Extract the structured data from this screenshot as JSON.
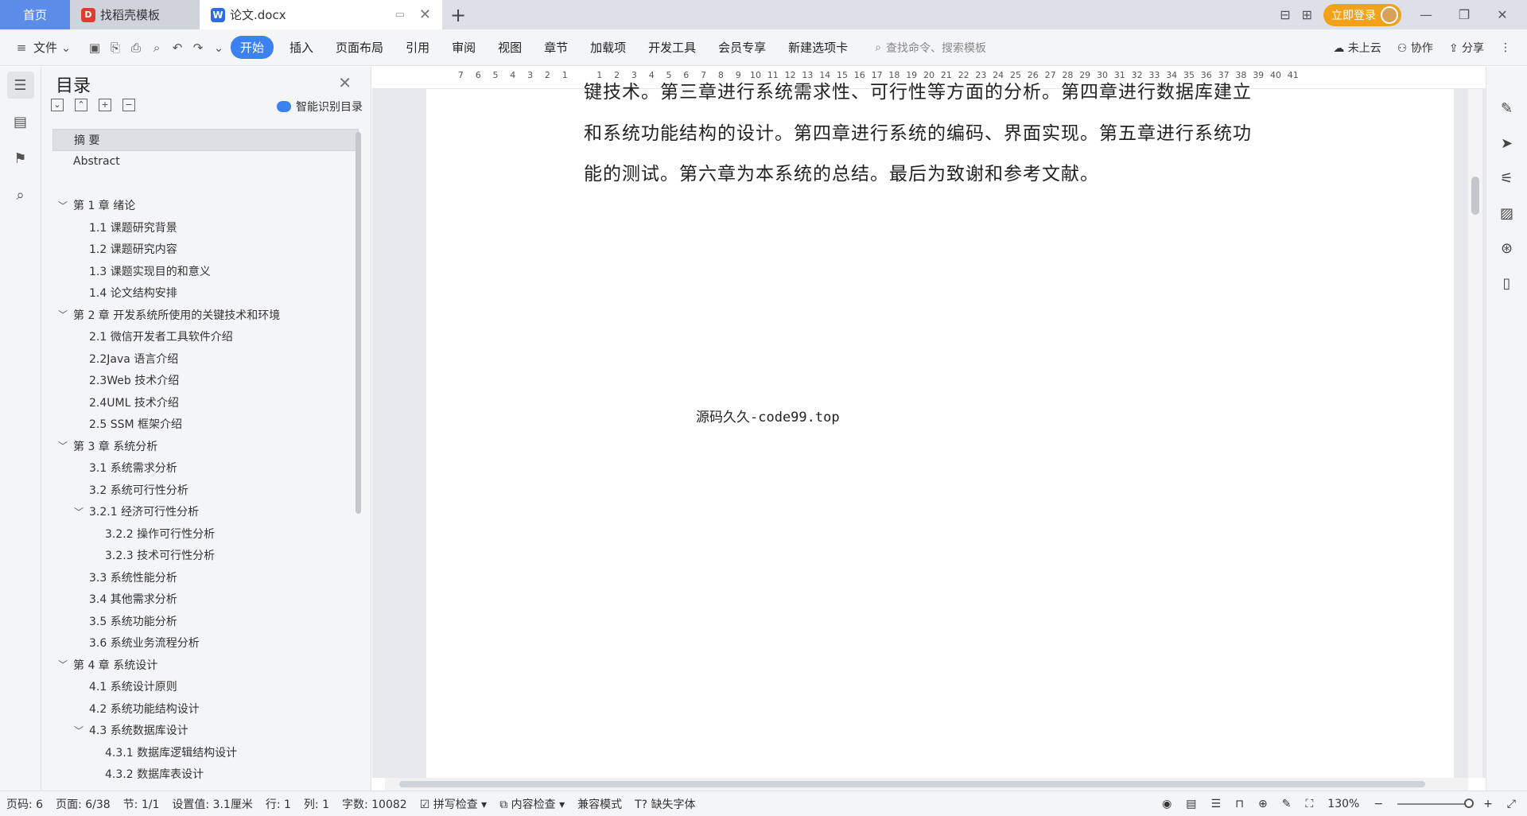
{
  "tabs": [
    {
      "label": "首页"
    },
    {
      "label": "找稻壳模板"
    },
    {
      "label": "论文.docx"
    }
  ],
  "titlebar": {
    "login_label": "立即登录"
  },
  "toolbar": {
    "file_label": "文件",
    "menus": [
      "开始",
      "插入",
      "页面布局",
      "引用",
      "审阅",
      "视图",
      "章节",
      "加载项",
      "开发工具",
      "会员专享",
      "新建选项卡"
    ],
    "search_placeholder": "查找命令、搜索模板",
    "cloud_label": "未上云",
    "collab_label": "协作",
    "share_label": "分享"
  },
  "toc": {
    "title": "目录",
    "smart_label": "智能识别目录",
    "items": [
      {
        "label": "摘 要",
        "level": 0,
        "caret": ""
      },
      {
        "label": "Abstract",
        "level": 0,
        "caret": ""
      },
      {
        "label": "",
        "level": 0,
        "caret": ""
      },
      {
        "label": "第 1 章  绪论",
        "level": 0,
        "caret": "﹀"
      },
      {
        "label": "1.1 课题研究背景",
        "level": 1,
        "caret": ""
      },
      {
        "label": "1.2 课题研究内容",
        "level": 1,
        "caret": ""
      },
      {
        "label": "1.3 课题实现目的和意义",
        "level": 1,
        "caret": ""
      },
      {
        "label": "1.4 论文结构安排",
        "level": 1,
        "caret": ""
      },
      {
        "label": "第 2 章  开发系统所使用的关键技术和环境",
        "level": 0,
        "caret": "﹀"
      },
      {
        "label": "2.1 微信开发者工具软件介绍",
        "level": 1,
        "caret": ""
      },
      {
        "label": "2.2Java 语言介绍",
        "level": 1,
        "caret": ""
      },
      {
        "label": "2.3Web 技术介绍",
        "level": 1,
        "caret": ""
      },
      {
        "label": "2.4UML 技术介绍",
        "level": 1,
        "caret": ""
      },
      {
        "label": "2.5 SSM 框架介绍",
        "level": 1,
        "caret": ""
      },
      {
        "label": "第 3 章  系统分析",
        "level": 0,
        "caret": "﹀"
      },
      {
        "label": "3.1 系统需求分析",
        "level": 1,
        "caret": ""
      },
      {
        "label": "3.2 系统可行性分析",
        "level": 1,
        "caret": ""
      },
      {
        "label": "3.2.1 经济可行性分析",
        "level": 1,
        "caret": "﹀"
      },
      {
        "label": "3.2.2 操作可行性分析",
        "level": 2,
        "caret": ""
      },
      {
        "label": "3.2.3 技术可行性分析",
        "level": 2,
        "caret": ""
      },
      {
        "label": "3.3 系统性能分析",
        "level": 1,
        "caret": ""
      },
      {
        "label": "3.4 其他需求分析",
        "level": 1,
        "caret": ""
      },
      {
        "label": "3.5 系统功能分析",
        "level": 1,
        "caret": ""
      },
      {
        "label": "3.6 系统业务流程分析",
        "level": 1,
        "caret": ""
      },
      {
        "label": "第 4 章  系统设计",
        "level": 0,
        "caret": "﹀"
      },
      {
        "label": "4.1 系统设计原则",
        "level": 1,
        "caret": ""
      },
      {
        "label": "4.2 系统功能结构设计",
        "level": 1,
        "caret": ""
      },
      {
        "label": "4.3 系统数据库设计",
        "level": 1,
        "caret": "﹀"
      },
      {
        "label": "4.3.1 数据库逻辑结构设计",
        "level": 2,
        "caret": ""
      },
      {
        "label": "4.3.2 数据库表设计",
        "level": 2,
        "caret": ""
      }
    ]
  },
  "ruler": {
    "left": [
      "7",
      "6",
      "5",
      "4",
      "3",
      "2",
      "1"
    ],
    "right": [
      "1",
      "2",
      "3",
      "4",
      "5",
      "6",
      "7",
      "8",
      "9",
      "10",
      "11",
      "12",
      "13",
      "14",
      "15",
      "16",
      "17",
      "18",
      "19",
      "20",
      "21",
      "22",
      "23",
      "24",
      "25",
      "26",
      "27",
      "28",
      "29",
      "30",
      "31",
      "32",
      "33",
      "34",
      "35",
      "36",
      "37",
      "38",
      "39",
      "40",
      "41"
    ]
  },
  "document": {
    "lines": [
      "键技术。第三章进行系统需求性、可行性等方面的分析。第四章进行数据库建立",
      "和系统功能结构的设计。第四章进行系统的编码、界面实现。第五章进行系统功",
      "能的测试。第六章为本系统的总结。最后为致谢和参考文献。"
    ],
    "watermark": "源码久久-code99.top"
  },
  "status": {
    "page_code": "页码: 6",
    "page": "页面: 6/38",
    "section": "节: 1/1",
    "setting": "设置值: 3.1厘米",
    "row": "行: 1",
    "col": "列: 1",
    "words": "字数: 10082",
    "spell": "拼写检查",
    "content_check": "内容检查",
    "compat": "兼容模式",
    "missing_font": "缺失字体",
    "zoom": "130%"
  }
}
